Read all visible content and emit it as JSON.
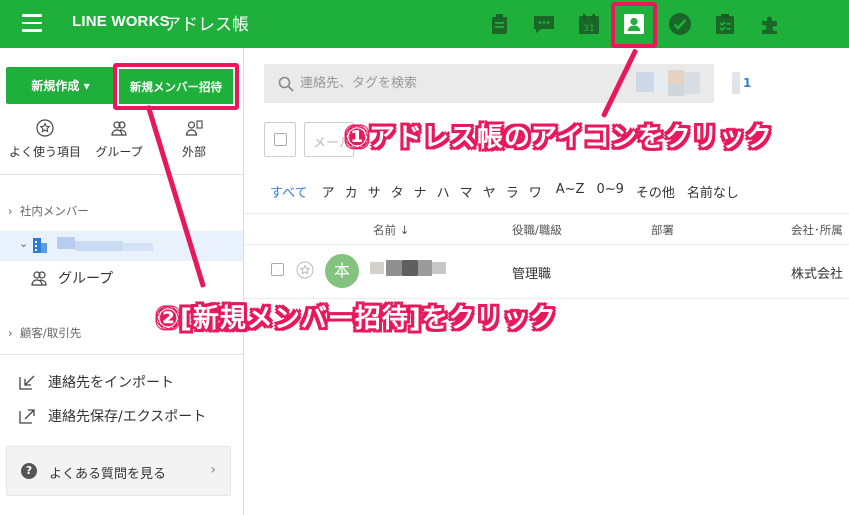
{
  "header": {
    "brand": "LINE WORKS",
    "app_name": "アドレス帳",
    "icons": [
      "note-icon",
      "chat-icon",
      "calendar-icon",
      "address-book-icon",
      "task-icon",
      "survey-icon",
      "more-apps-icon"
    ],
    "calendar_day": "31"
  },
  "sidebar": {
    "new_button": "新規作成 ▾",
    "invite_button": "新規メンバー招待",
    "shortcuts": [
      {
        "label": "よく使う項目"
      },
      {
        "label": "グループ"
      },
      {
        "label": "外部"
      }
    ],
    "section_internal": "社内メンバー",
    "group_label": "グループ",
    "section_customers": "顧客/取引先",
    "import_label": "連絡先をインポート",
    "export_label": "連絡先保存/エクスポート",
    "faq_label": "よくある質問を見る"
  },
  "main": {
    "search_placeholder": "連絡先、タグを検索",
    "mail_field": "メール",
    "counter": "1",
    "index": [
      "すべて",
      "ア",
      "カ",
      "サ",
      "タ",
      "ナ",
      "ハ",
      "マ",
      "ヤ",
      "ラ",
      "ワ",
      "A~Z",
      "0~9",
      "その他",
      "名前なし"
    ],
    "columns": {
      "name": "名前 ↓",
      "title": "役職/職級",
      "dept": "部署",
      "company": "会社･所属"
    },
    "row": {
      "avatar": "本",
      "title": "管理職",
      "company": "株式会社"
    }
  },
  "annotations": {
    "step1": "①アドレス帳のアイコンをクリック",
    "step2": "②[新規メンバー招待]をクリック"
  },
  "colors": {
    "brand_green": "#1fb03c",
    "highlight": "#e8195b",
    "link_blue": "#3a7fd5"
  }
}
